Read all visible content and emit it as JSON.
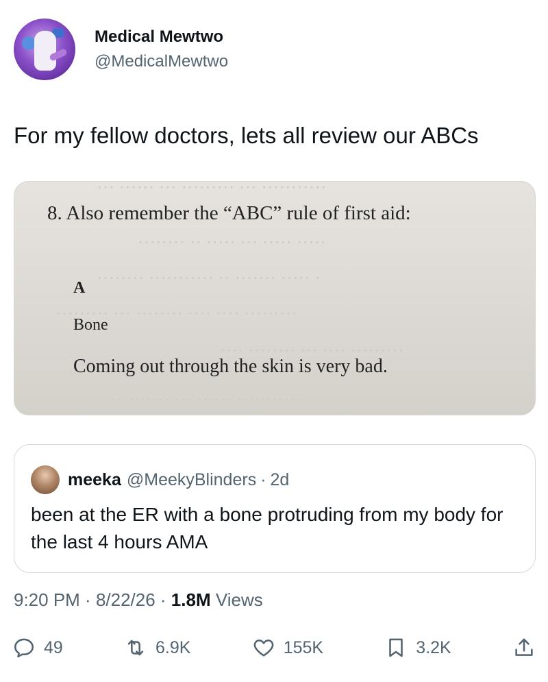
{
  "author": {
    "display_name": "Medical Mewtwo",
    "handle": "@MedicalMewtwo"
  },
  "tweet": {
    "text": "For my fellow doctors, lets all review our ABCs"
  },
  "media": {
    "heading": "8. Also remember the “ABC” rule of first aid:",
    "line_a": "A",
    "line_b": "Bone",
    "line_c": "Coming out through the skin is very bad."
  },
  "quote": {
    "name": "meeka",
    "handle": "@MeekyBlinders",
    "separator": "·",
    "time": "2d",
    "text": "been at the ER with a bone protruding from my body for the last 4 hours AMA"
  },
  "meta": {
    "time": "9:20 PM",
    "sep1": " · ",
    "date": "8/22/26",
    "sep2": " · ",
    "views_count": "1.8M",
    "views_label": " Views"
  },
  "actions": {
    "replies": "49",
    "reposts": "6.9K",
    "likes": "155K",
    "bookmarks": "3.2K"
  },
  "icons": {
    "reply": "reply-icon",
    "repost": "repost-icon",
    "like": "heart-icon",
    "bookmark": "bookmark-icon",
    "share": "share-icon"
  },
  "colors": {
    "text_primary": "#0f1419",
    "text_secondary": "#536471",
    "border": "#cfd9de"
  }
}
